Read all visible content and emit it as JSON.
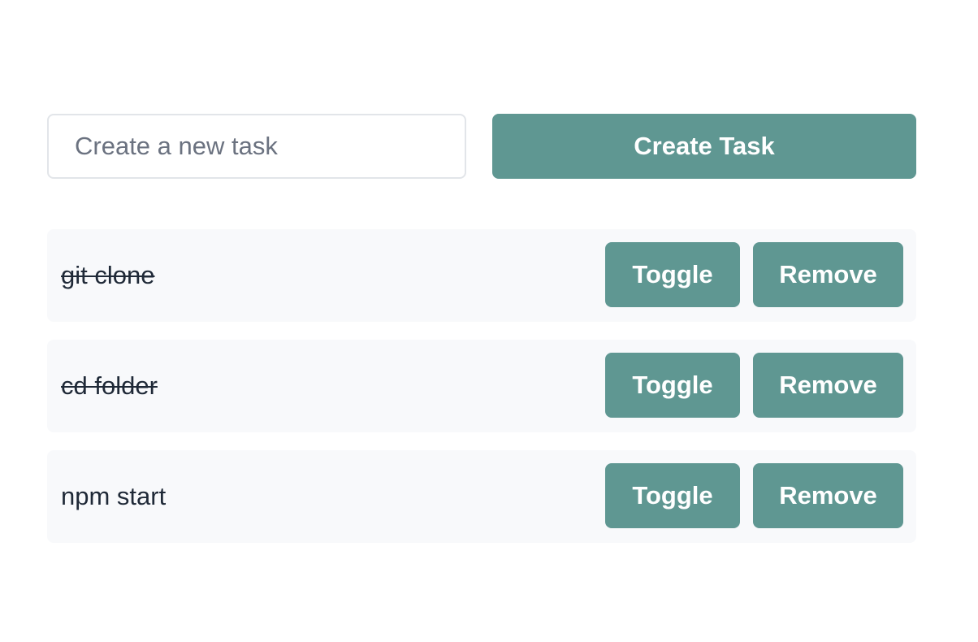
{
  "create_form": {
    "input_value": "",
    "input_placeholder": "Create a new task",
    "create_button_label": "Create Task"
  },
  "tasks": [
    {
      "label": "git clone",
      "completed": true,
      "toggle_label": "Toggle",
      "remove_label": "Remove"
    },
    {
      "label": "cd folder",
      "completed": true,
      "toggle_label": "Toggle",
      "remove_label": "Remove"
    },
    {
      "label": "npm start",
      "completed": false,
      "toggle_label": "Toggle",
      "remove_label": "Remove"
    }
  ],
  "colors": {
    "accent": "#5f9792",
    "row_background": "#f8f9fb",
    "text": "#1f2937",
    "placeholder": "#6b7280",
    "input_border": "#e2e5e9"
  }
}
